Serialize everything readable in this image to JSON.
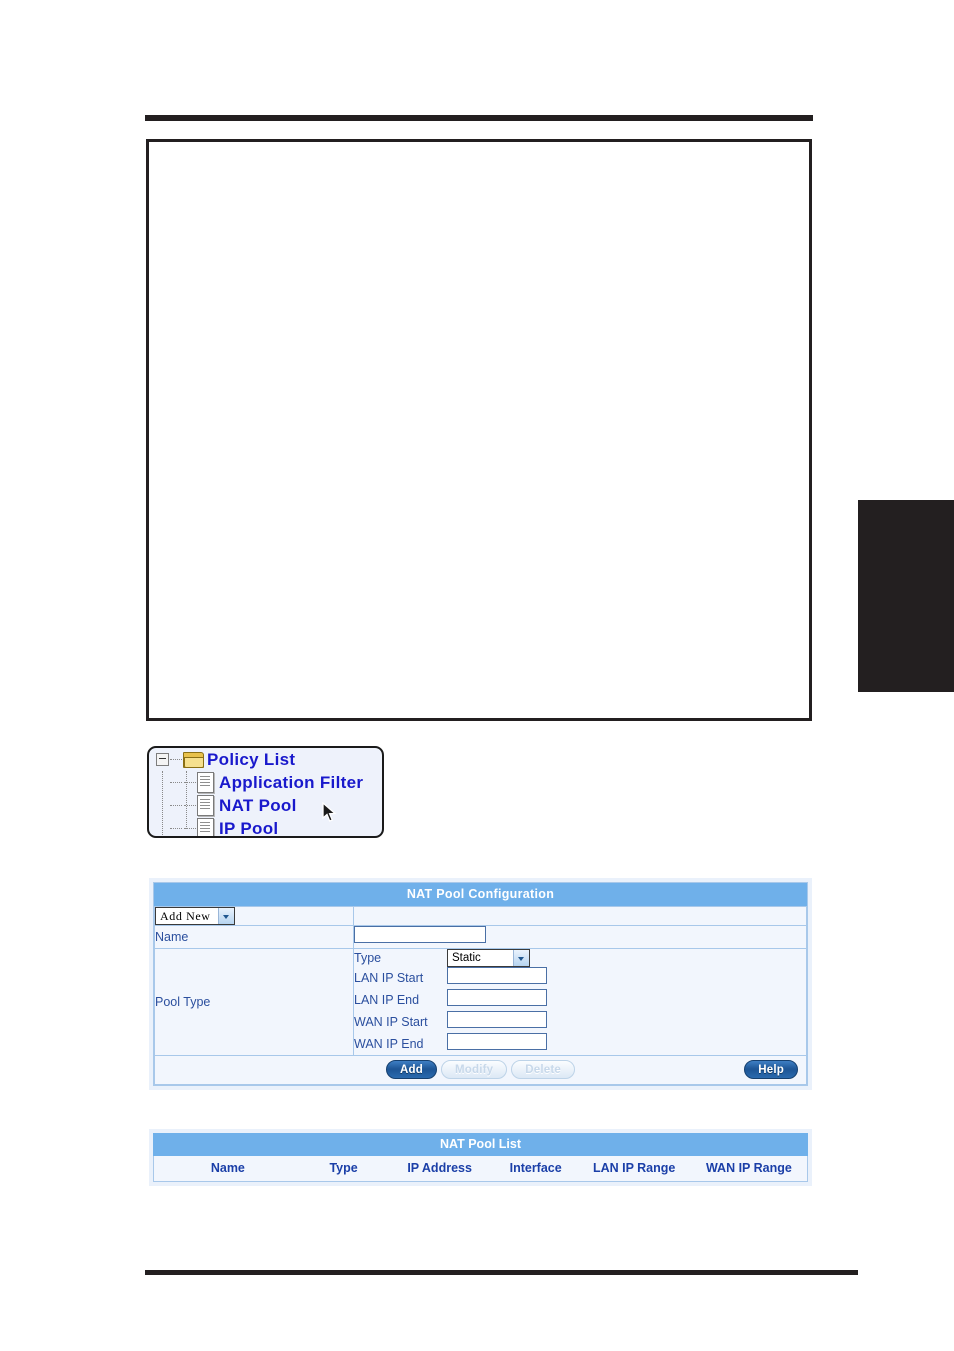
{
  "page": {
    "top_rule": true,
    "bottom_rule": true,
    "side_tab_color": "#231f20",
    "screenshot_placeholder": ""
  },
  "tree": {
    "title": "Policy List",
    "items": [
      {
        "label": "Policy List",
        "icon": "folder-icon",
        "level": 0,
        "expander": "minus"
      },
      {
        "label": "Application Filter",
        "icon": "document-icon",
        "level": 1
      },
      {
        "label": "NAT Pool",
        "icon": "document-icon",
        "level": 1
      },
      {
        "label": "IP Pool",
        "icon": "document-icon",
        "level": 1
      }
    ],
    "cursor": "mouse-pointer"
  },
  "config": {
    "title": "NAT Pool Configuration",
    "action_select": {
      "value": "Add New",
      "options": [
        "Add New"
      ]
    },
    "name_row": {
      "label": "Name",
      "value": "",
      "placeholder": ""
    },
    "pool_type": {
      "label": "Pool Type",
      "fields": [
        {
          "label": "Type",
          "kind": "select",
          "value": "Static",
          "options": [
            "Static"
          ]
        },
        {
          "label": "LAN IP Start",
          "kind": "text",
          "value": ""
        },
        {
          "label": "LAN IP End",
          "kind": "text",
          "value": ""
        },
        {
          "label": "WAN IP Start",
          "kind": "text",
          "value": ""
        },
        {
          "label": "WAN IP End",
          "kind": "text",
          "value": ""
        }
      ]
    },
    "buttons": {
      "add": "Add",
      "modify": "Modify",
      "delete": "Delete",
      "help": "Help"
    },
    "button_states": {
      "add": "enabled",
      "modify": "disabled",
      "delete": "disabled",
      "help": "enabled"
    }
  },
  "list": {
    "title": "NAT Pool List",
    "columns": [
      "Name",
      "Type",
      "IP Address",
      "Interface",
      "LAN IP Range",
      "WAN IP Range"
    ],
    "rows": []
  },
  "colors": {
    "panel_header": "#6fb0ea",
    "panel_body": "#f2f6fd",
    "panel_frame": "#eaf1fb",
    "label_text": "#2b4f9e",
    "column_text": "#1b3fa8",
    "tree_text": "#1919cc",
    "rule": "#231f20"
  }
}
